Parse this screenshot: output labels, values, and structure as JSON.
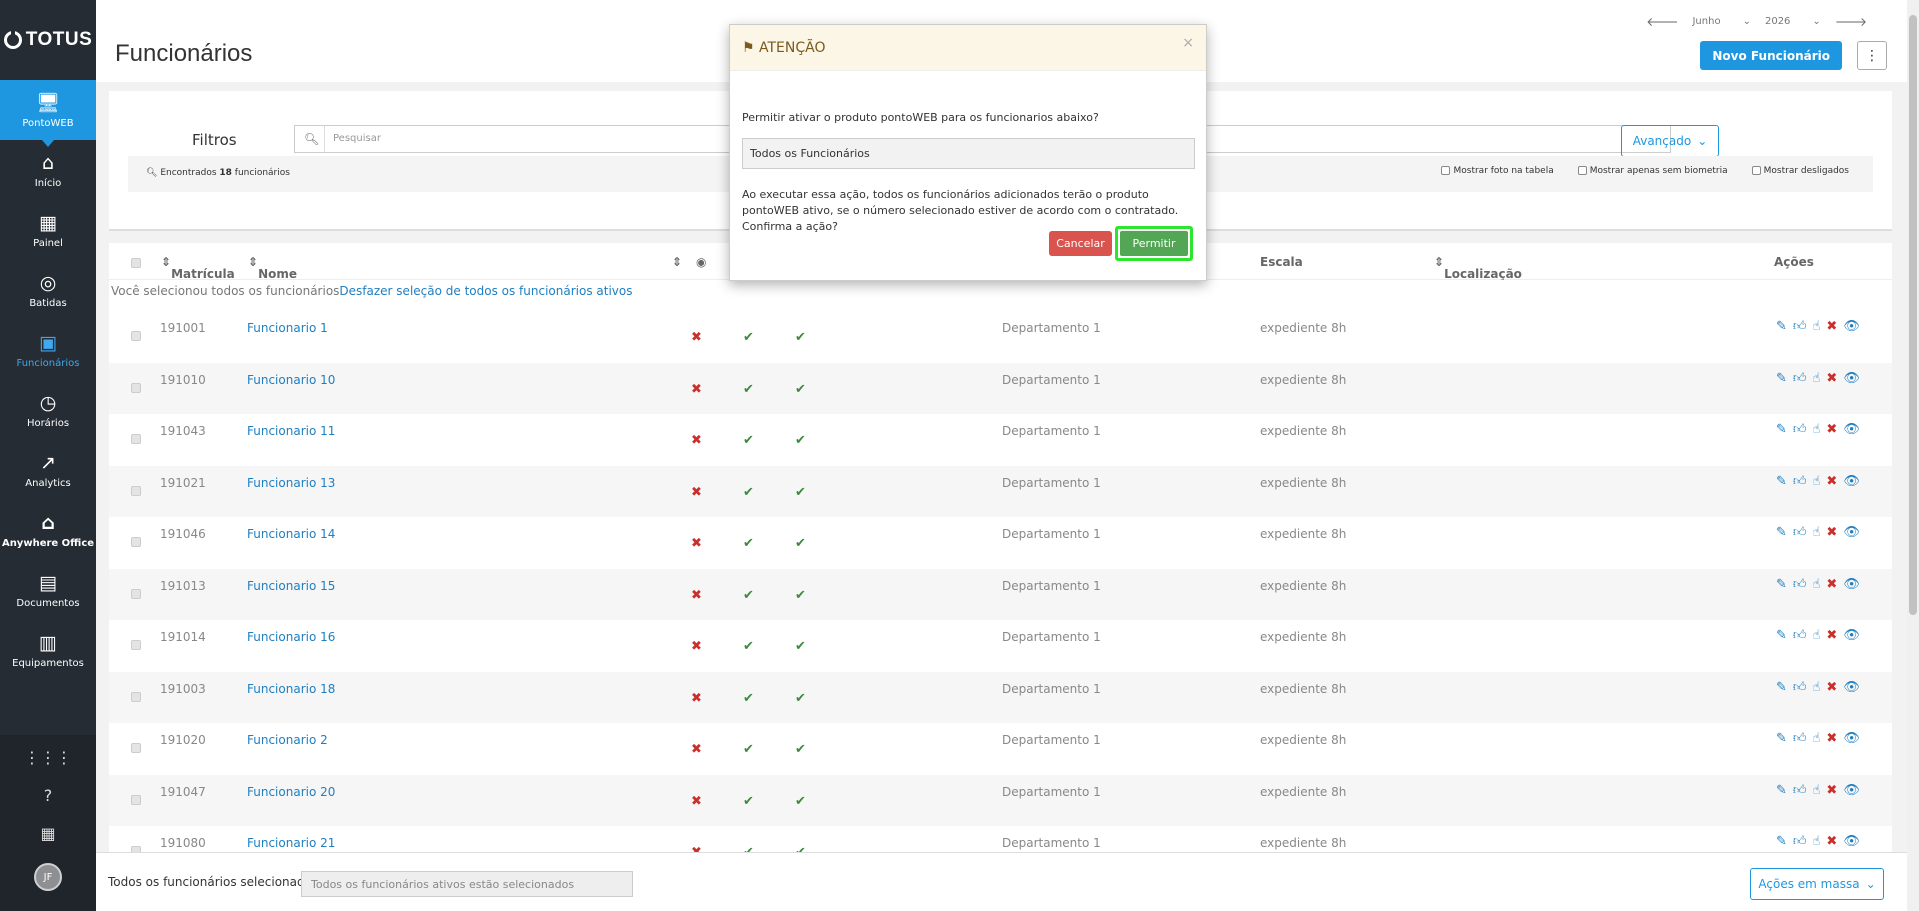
{
  "sidebar": {
    "brand": "TOTUS",
    "items": [
      {
        "label": "PontoWEB",
        "icon": "monitor-icon"
      },
      {
        "label": "Início",
        "icon": "home-icon"
      },
      {
        "label": "Painel",
        "icon": "dashboard-icon"
      },
      {
        "label": "Batidas",
        "icon": "fingerprint-icon"
      },
      {
        "label": "Funcionários",
        "icon": "badge-icon"
      },
      {
        "label": "Horários",
        "icon": "clock-icon"
      },
      {
        "label": "Analytics",
        "icon": "trend-icon"
      },
      {
        "label": "Anywhere Office",
        "icon": "office-icon"
      },
      {
        "label": "Documentos",
        "icon": "document-icon"
      },
      {
        "label": "Equipamentos",
        "icon": "equipment-icon"
      }
    ],
    "avatar_initials": "JF"
  },
  "header": {
    "title": "Funcionários",
    "month": "Junho",
    "year": "2026",
    "new_button": "Novo Funcionário"
  },
  "filters": {
    "label": "Filtros",
    "search_placeholder": "Pesquisar",
    "advanced_button": "Avançado",
    "found_prefix": "Encontrados",
    "found_count": "18",
    "found_suffix": "funcionários",
    "options": [
      "Mostrar foto na tabela",
      "Mostrar apenas sem biometria",
      "Mostrar desligados"
    ]
  },
  "table": {
    "columns": {
      "matricula": "Matrícula",
      "nome": "Nome",
      "escala": "Escala",
      "localizacao": "Localização",
      "acoes": "Ações"
    },
    "notice_text": "Você selecionou todos os funcionários",
    "notice_link": "Desfazer seleção de todos os funcionários ativos",
    "rows": [
      {
        "matricula": "191001",
        "nome": "Funcionario 1",
        "departamento": "Departamento 1",
        "escala": "expediente 8h"
      },
      {
        "matricula": "191010",
        "nome": "Funcionario 10",
        "departamento": "Departamento 1",
        "escala": "expediente 8h"
      },
      {
        "matricula": "191043",
        "nome": "Funcionario 11",
        "departamento": "Departamento 1",
        "escala": "expediente 8h"
      },
      {
        "matricula": "191021",
        "nome": "Funcionario 13",
        "departamento": "Departamento 1",
        "escala": "expediente 8h"
      },
      {
        "matricula": "191046",
        "nome": "Funcionario 14",
        "departamento": "Departamento 1",
        "escala": "expediente 8h"
      },
      {
        "matricula": "191013",
        "nome": "Funcionario 15",
        "departamento": "Departamento 1",
        "escala": "expediente 8h"
      },
      {
        "matricula": "191014",
        "nome": "Funcionario 16",
        "departamento": "Departamento 1",
        "escala": "expediente 8h"
      },
      {
        "matricula": "191003",
        "nome": "Funcionario 18",
        "departamento": "Departamento 1",
        "escala": "expediente 8h"
      },
      {
        "matricula": "191020",
        "nome": "Funcionario 2",
        "departamento": "Departamento 1",
        "escala": "expediente 8h"
      },
      {
        "matricula": "191047",
        "nome": "Funcionario 20",
        "departamento": "Departamento 1",
        "escala": "expediente 8h"
      },
      {
        "matricula": "191080",
        "nome": "Funcionario 21",
        "departamento": "Departamento 1",
        "escala": "expediente 8h"
      }
    ]
  },
  "bottombar": {
    "label": "Todos os funcionários selecionados",
    "readonly_value": "Todos os funcionários ativos estão selecionados",
    "mass_button": "Ações em massa"
  },
  "modal": {
    "title": "ATENÇÃO",
    "question": "Permitir ativar o produto pontoWEB para os funcionarios abaixo?",
    "field_value": "Todos os Funcionários",
    "warning": "Ao executar essa ação, todos os funcionários adicionados terão o produto pontoWEB ativo, se o número selecionado estiver de acordo com o contratado. Confirma a ação?",
    "cancel_button": "Cancelar",
    "confirm_button": "Permitir"
  },
  "colors": {
    "primary": "#1f97e0",
    "sidebar": "#262c33",
    "danger": "#d9534f",
    "success": "#53a653",
    "highlight": "#2ee52e"
  }
}
